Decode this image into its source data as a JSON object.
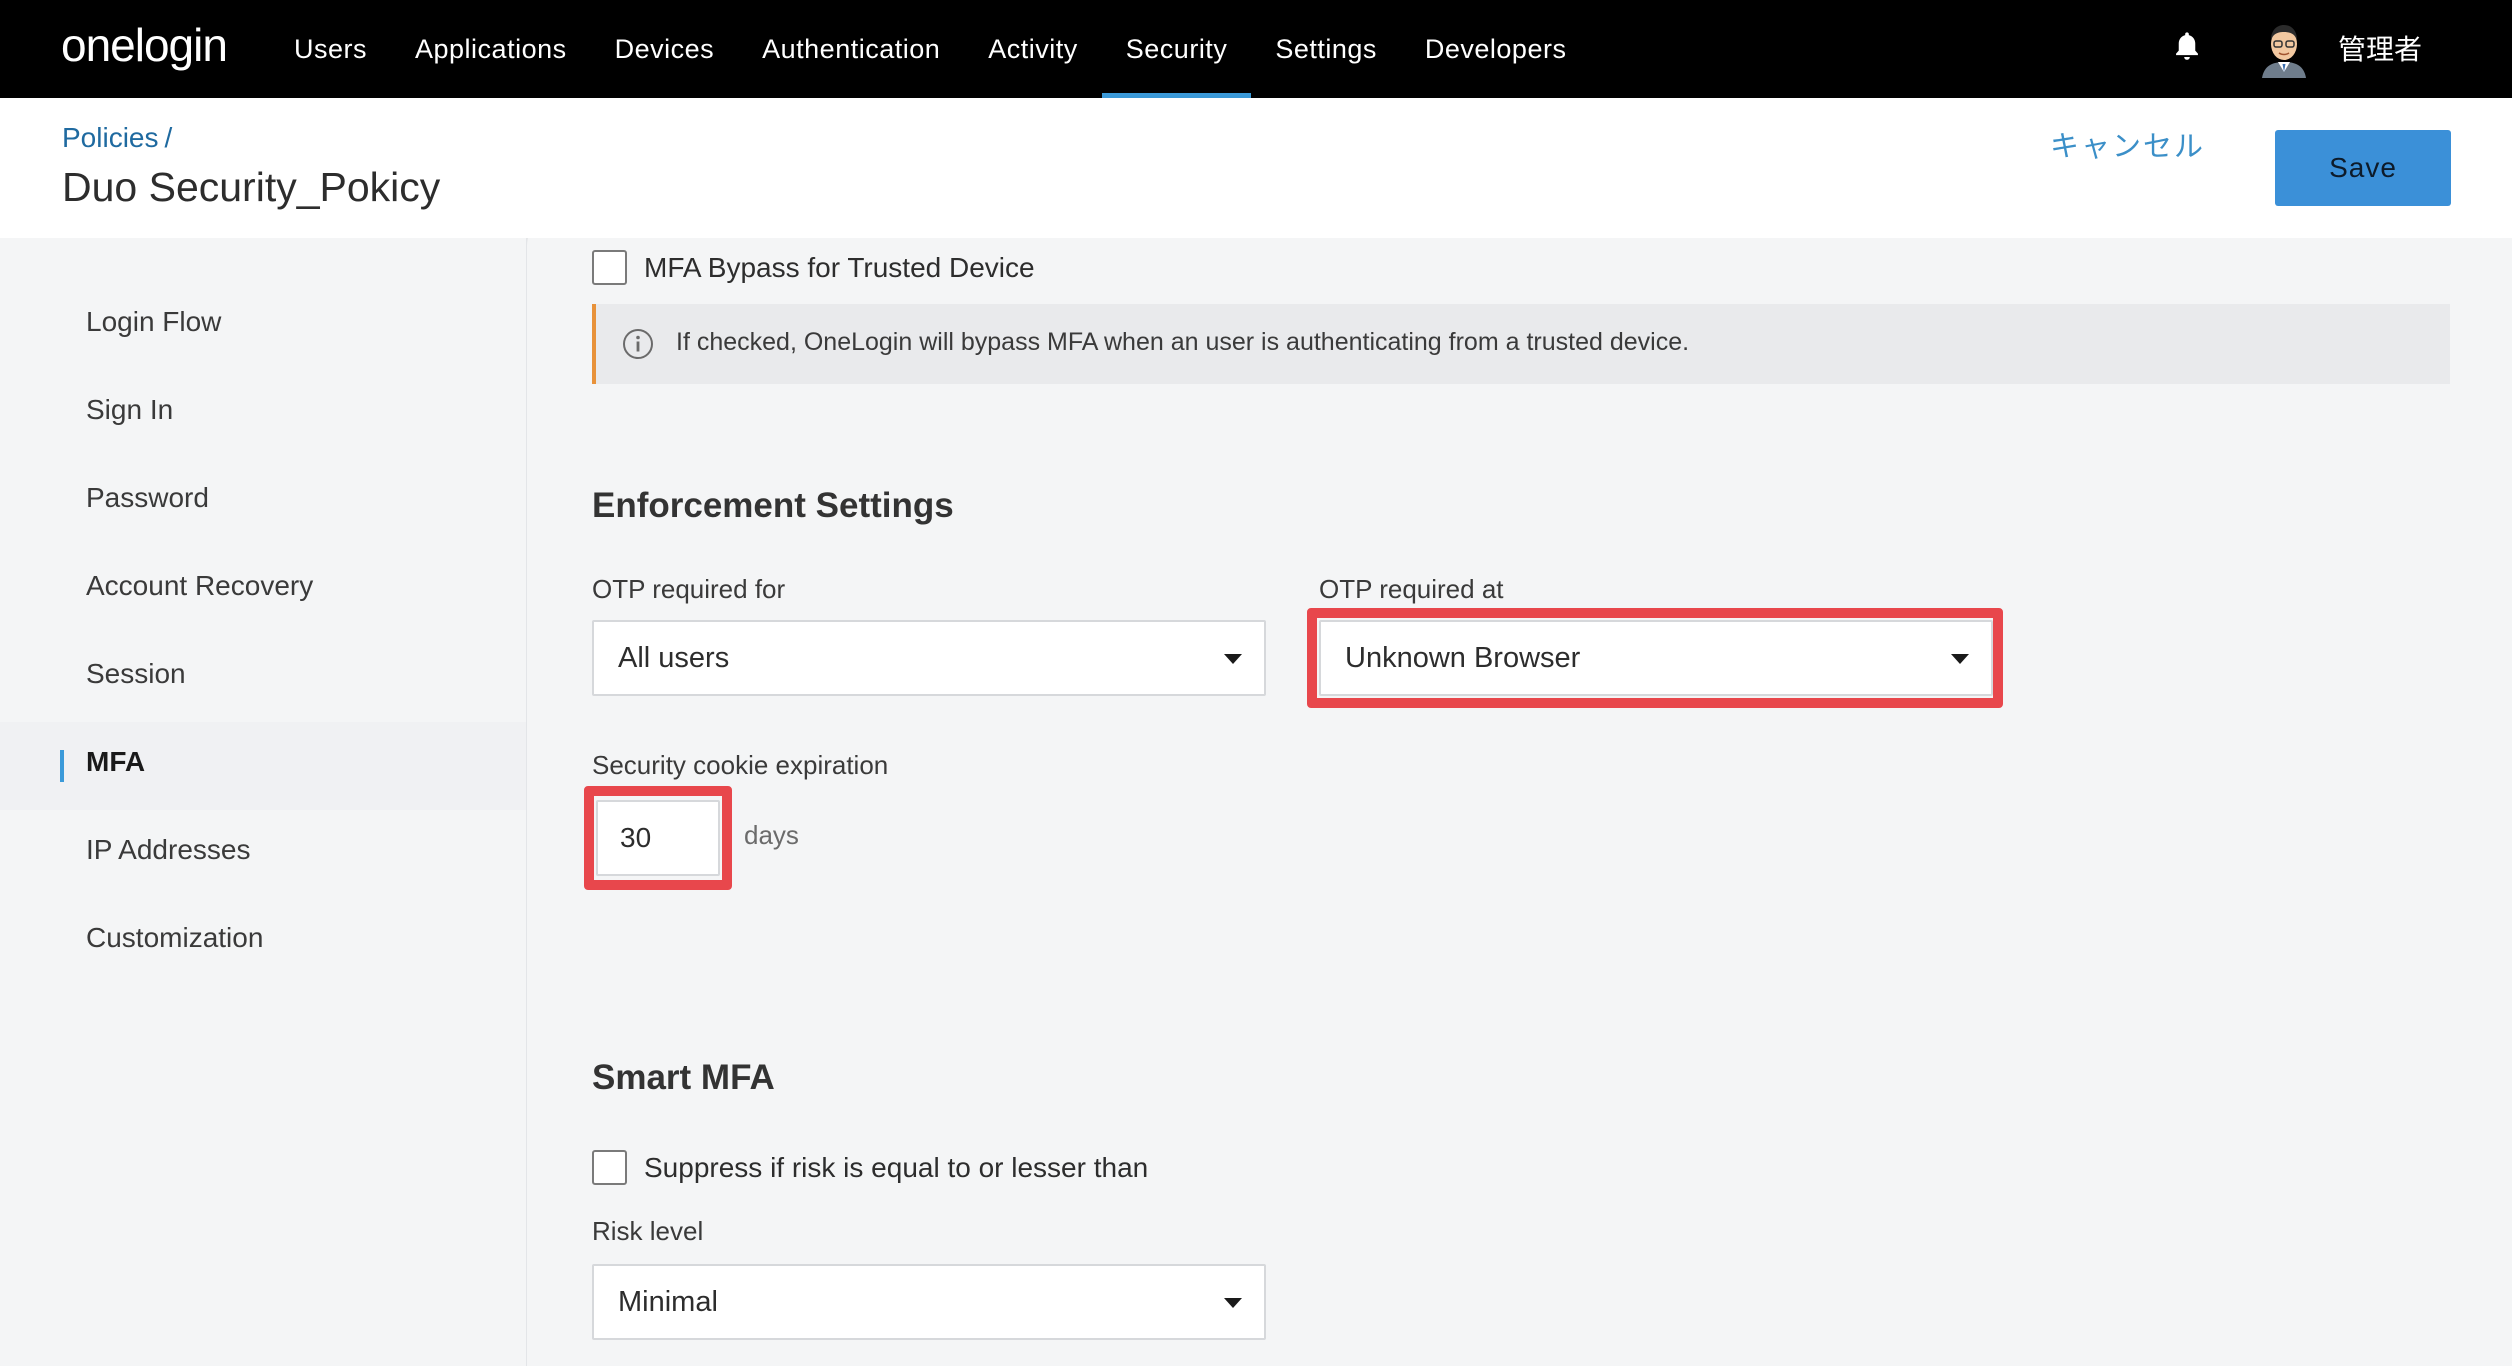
{
  "app": {
    "logo_text": "onelogin",
    "user_name": "管理者"
  },
  "nav": {
    "items": [
      {
        "label": "Users"
      },
      {
        "label": "Applications"
      },
      {
        "label": "Devices"
      },
      {
        "label": "Authentication"
      },
      {
        "label": "Activity"
      },
      {
        "label": "Security"
      },
      {
        "label": "Settings"
      },
      {
        "label": "Developers"
      }
    ],
    "active": "Security"
  },
  "header": {
    "breadcrumb": "Policies",
    "breadcrumb_sep": "/",
    "title": "Duo Security_Pokicy",
    "cancel_label": "キャンセル",
    "save_label": "Save"
  },
  "sidebar": {
    "items": [
      {
        "label": "Login Flow"
      },
      {
        "label": "Sign In"
      },
      {
        "label": "Password"
      },
      {
        "label": "Account Recovery"
      },
      {
        "label": "Session"
      },
      {
        "label": "MFA"
      },
      {
        "label": "IP Addresses"
      },
      {
        "label": "Customization"
      }
    ],
    "active": "MFA"
  },
  "main": {
    "bypass_label": "MFA Bypass for Trusted Device",
    "bypass_info": "If checked, OneLogin will bypass MFA when an user is authenticating from a trusted device.",
    "enforcement": {
      "title": "Enforcement Settings",
      "otp_for_label": "OTP required for",
      "otp_for_value": "All users",
      "otp_at_label": "OTP required at",
      "otp_at_value": "Unknown Browser",
      "cookie_label": "Security cookie expiration",
      "cookie_value": "30",
      "cookie_unit": "days"
    },
    "smart_mfa": {
      "title": "Smart MFA",
      "suppress_label": "Suppress if risk is equal to or lesser than",
      "risk_label": "Risk level",
      "risk_value": "Minimal"
    }
  },
  "colors": {
    "accent": "#3b9ad9",
    "highlight": "#e8474c",
    "info_border": "#e8923a",
    "save_button": "#3b90d8"
  }
}
